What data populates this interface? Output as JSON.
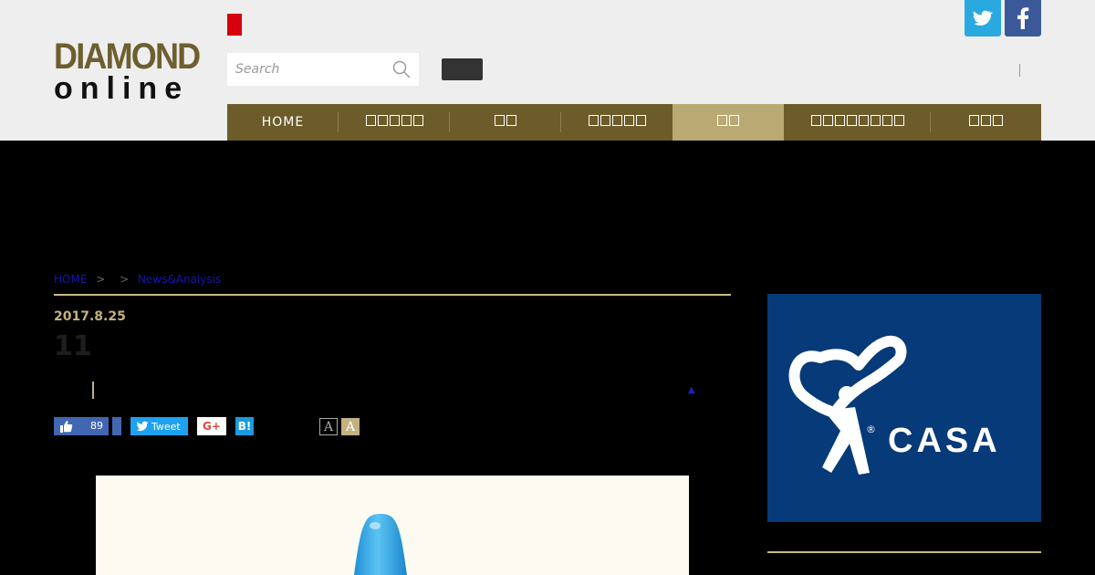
{
  "header": {
    "logo_line1": "DIAMOND",
    "logo_line2": "online",
    "search_placeholder": "Search",
    "social": [
      "twitter-icon",
      "facebook-icon"
    ]
  },
  "nav": {
    "items": [
      {
        "label": "HOME",
        "boxes": 0
      },
      {
        "label": "",
        "boxes": 5
      },
      {
        "label": "",
        "boxes": 2
      },
      {
        "label": "",
        "boxes": 5
      },
      {
        "label": "",
        "boxes": 2,
        "active": true
      },
      {
        "label": "",
        "boxes": 8
      },
      {
        "label": "",
        "boxes": 3
      }
    ]
  },
  "breadcrumb": {
    "home": "HOME",
    "sep": ">",
    "section": "News&Analysis"
  },
  "article": {
    "date": "2017.8.25",
    "title": "11"
  },
  "share": {
    "like_count": "89",
    "tweet_label": "Tweet",
    "gplus_label": "G+",
    "hatena_label": "B!",
    "font_small": "A",
    "font_large": "A"
  },
  "ad": {
    "brand": "CASA",
    "reg": "®"
  },
  "colors": {
    "header_bg": "#eeeeee",
    "nav_bg": "#6c5c2a",
    "nav_active": "#b9a973",
    "accent_gold": "#c3b180",
    "twitter": "#2aa8e0",
    "facebook": "#3b5998",
    "ad_bg": "#063a78"
  }
}
